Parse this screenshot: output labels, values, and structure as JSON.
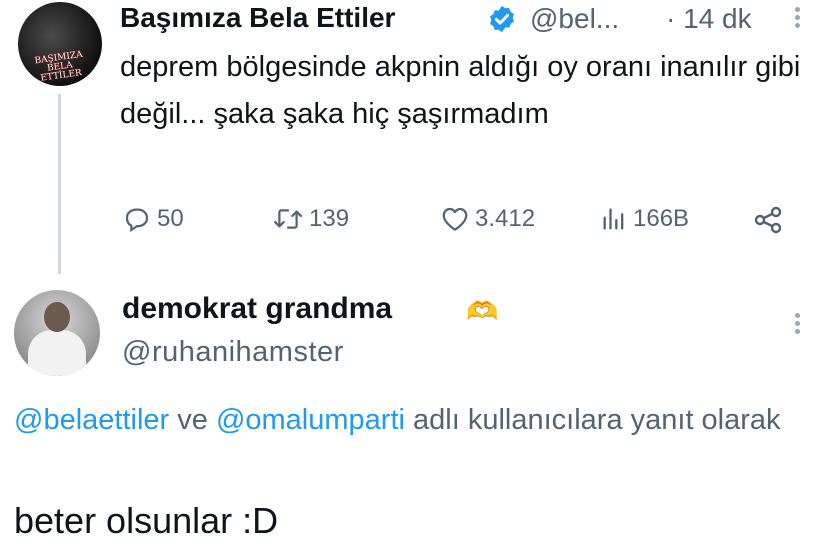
{
  "tweet": {
    "avatar_logo_text": "BAŞIMIZA BELA ETTİLER",
    "author_name": "Başımıza Bela Ettiler",
    "verified": true,
    "handle": "@bel...",
    "time": "· 14 dk",
    "text": "deprem bölgesinde akpnin aldığı oy oranı inanılır gibi değil... şaka şaka hiç şaşırmadım",
    "stats": {
      "replies": "50",
      "retweets": "139",
      "likes": "3.412",
      "views": "166B"
    },
    "icons": [
      "reply-icon",
      "retweet-icon",
      "like-icon",
      "views-icon",
      "share-icon",
      "more-icon"
    ]
  },
  "reply": {
    "author_name": "demokrat grandma",
    "emoji": "🫶",
    "handle": "@ruhanihamster",
    "replying_mentions": [
      "@belaettiler",
      "@omalumparti"
    ],
    "replying_connector": "ve",
    "replying_suffix": "adlı kullanıcılara yanıt olarak",
    "text": "beter olsunlar :D"
  },
  "colors": {
    "accent": "#1d9bf0",
    "secondary_text": "#536471",
    "primary_text": "#0f1419"
  }
}
